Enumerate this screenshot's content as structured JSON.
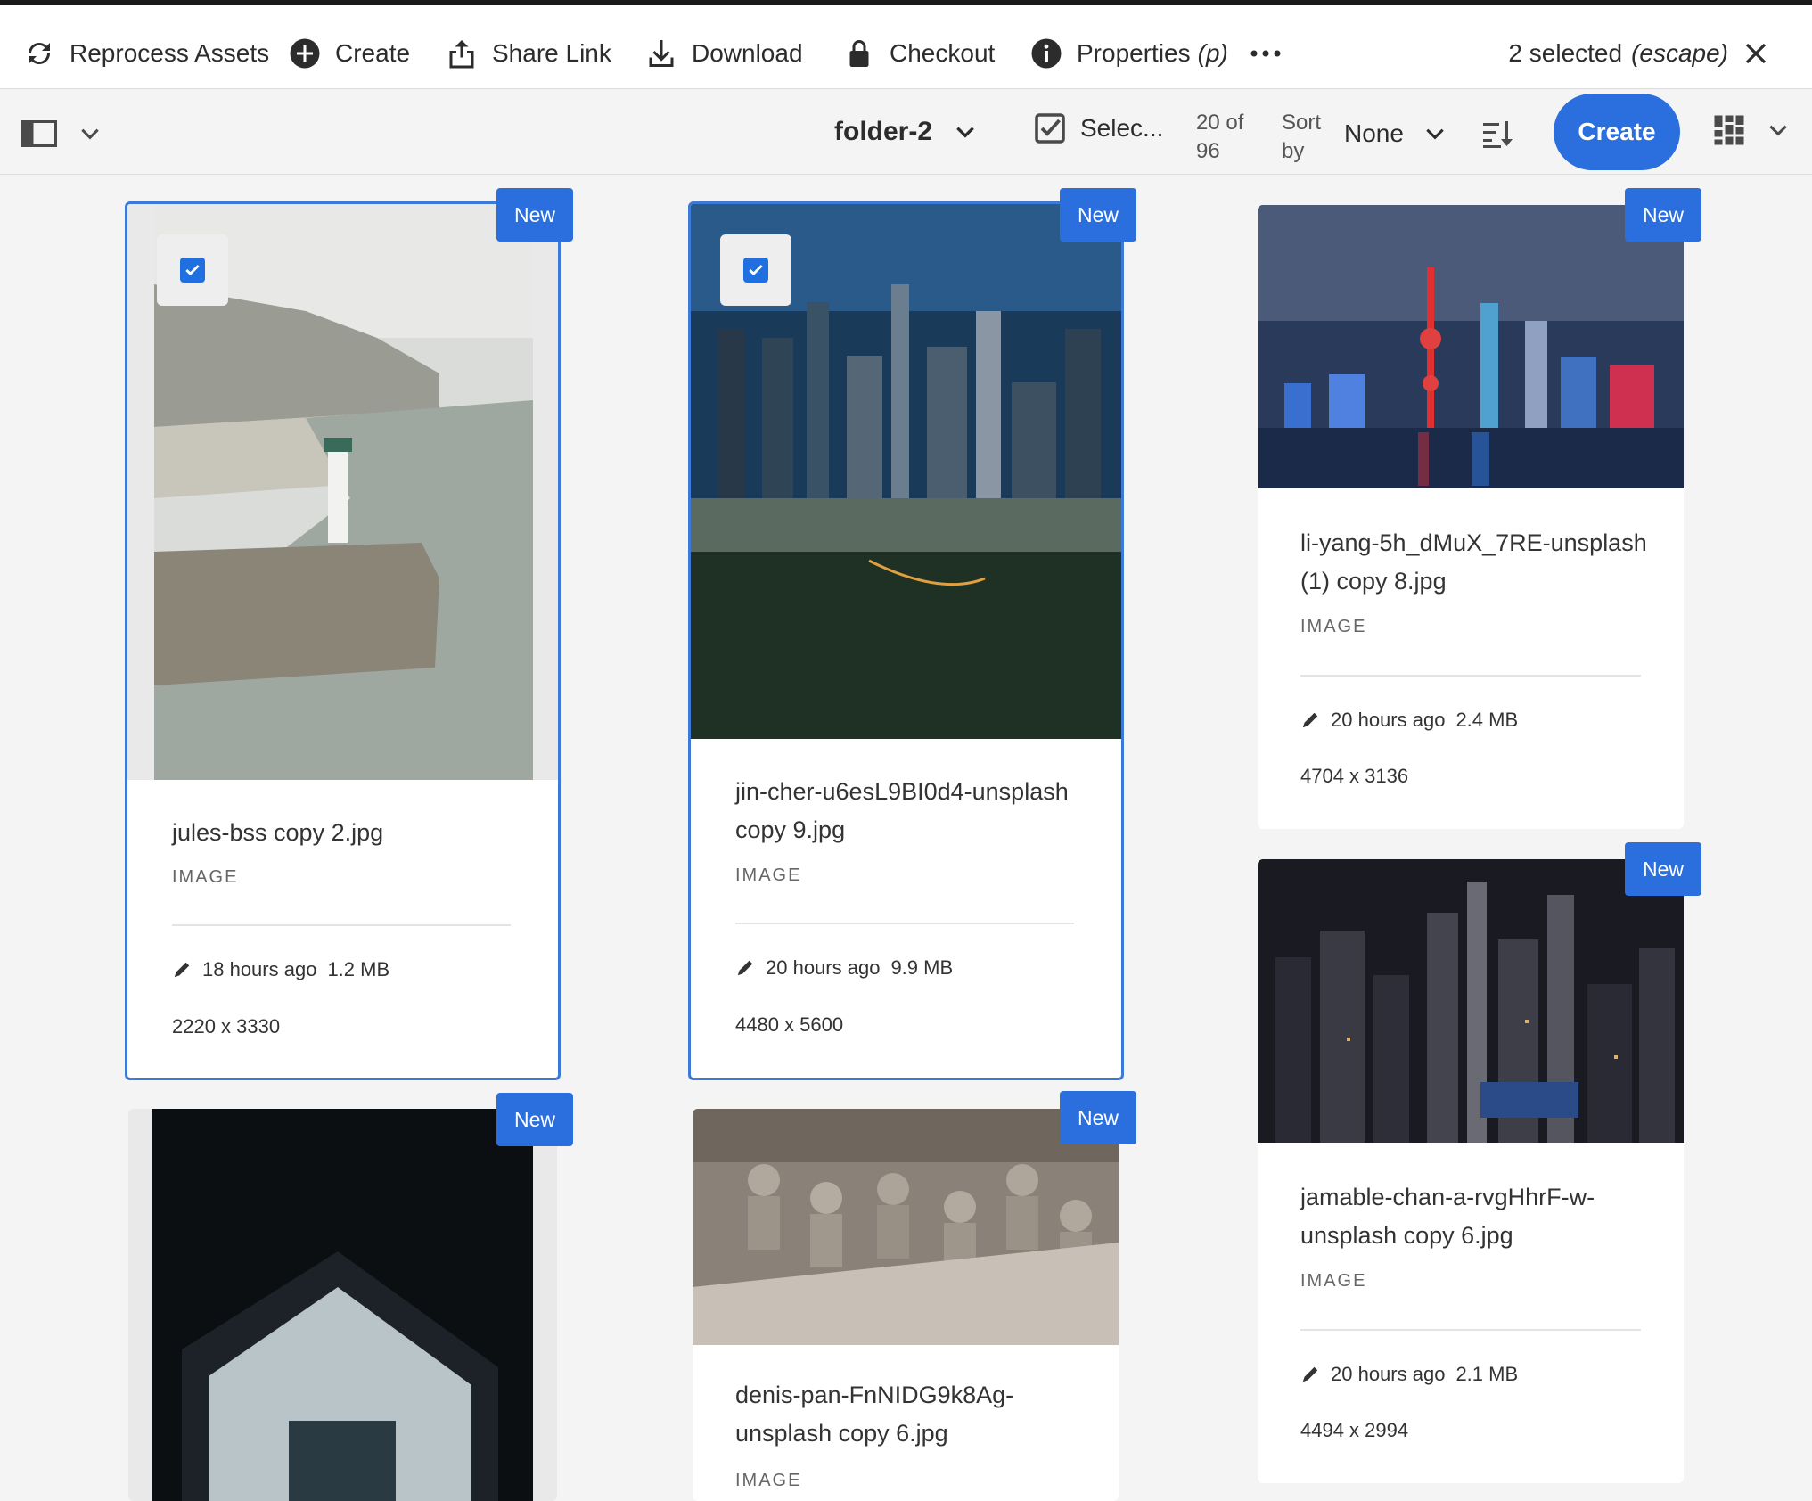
{
  "actionbar": {
    "reprocess": "Reprocess Assets",
    "create": "Create",
    "share_link": "Share Link",
    "download": "Download",
    "checkout": "Checkout",
    "properties": "Properties",
    "properties_shortcut": "(p)",
    "selected": "2 selected",
    "selected_hint": "(escape)"
  },
  "toolbar": {
    "folder": "folder-2",
    "select_all": "Selec...",
    "count": "20 of 96",
    "sort_label": "Sort by",
    "sort_value": "None",
    "create": "Create"
  },
  "badge_label": "New",
  "cards": [
    {
      "name": "jules-bss copy 2.jpg",
      "type": "IMAGE",
      "modified": "18 hours ago",
      "size": "1.2 MB",
      "dims": "2220 x 3330",
      "selected": true
    },
    {
      "name": "jin-cher-u6esL9BI0d4-unsplash copy 9.jpg",
      "type": "IMAGE",
      "modified": "20 hours ago",
      "size": "9.9 MB",
      "dims": "4480 x 5600",
      "selected": true
    },
    {
      "name": "li-yang-5h_dMuX_7RE-unsplash (1) copy 8.jpg",
      "type": "IMAGE",
      "modified": "20 hours ago",
      "size": "2.4 MB",
      "dims": "4704 x 3136",
      "selected": false
    },
    {
      "name": "jamable-chan-a-rvgHhrF-w-unsplash copy 6.jpg",
      "type": "IMAGE",
      "modified": "20 hours ago",
      "size": "2.1 MB",
      "dims": "4494 x 2994",
      "selected": false
    },
    {
      "name": "",
      "type": "",
      "selected": false
    },
    {
      "name": "denis-pan-FnNIDG9k8Ag-unsplash copy 6.jpg",
      "type": "IMAGE",
      "selected": false
    }
  ],
  "colors": {
    "accent": "#2b6fdf",
    "selected_border": "#3d7ad8"
  }
}
